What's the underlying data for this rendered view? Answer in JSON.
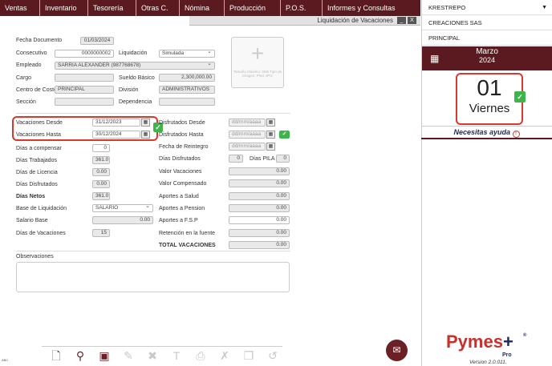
{
  "nav": [
    "Ventas",
    "Inventario",
    "Tesorería",
    "Otras C.",
    "Nómina",
    "Producción",
    "P.O.S.",
    "Informes y Consultas"
  ],
  "window": {
    "title": "Liquidación de Vacaciones",
    "minimize": "_",
    "close": "X"
  },
  "form": {
    "fecha_documento": {
      "label": "Fecha Documento",
      "value": "01/03/2024"
    },
    "consecutivo": {
      "label": "Consecutivo",
      "value": "0000000002"
    },
    "liquidacion": {
      "label": "Liquidación",
      "value": "Simulada"
    },
    "empleado": {
      "label": "Empleado",
      "value": "SARRIA ALEXANDER (987768678)"
    },
    "cargo": {
      "label": "Cargo",
      "value": ""
    },
    "sueldo_basico": {
      "label": "Sueldo Básico",
      "value": "2,300,000.00"
    },
    "centro_costo": {
      "label": "Centro de Costo",
      "value": "PRINCIPAL"
    },
    "division": {
      "label": "División",
      "value": "ADMINISTRATIVOS"
    },
    "seccion": {
      "label": "Sección",
      "value": ""
    },
    "dependencia": {
      "label": "Dependencia",
      "value": ""
    },
    "image_caption": "Tamaño Máximo: 5Mb Tipo de Imagen: PNG-JPG",
    "vacaciones_desde": {
      "label": "Vacaciones Desde",
      "value": "31/12/2023"
    },
    "vacaciones_hasta": {
      "label": "Vacaciones Hasta",
      "value": "30/12/2024"
    },
    "dias_compensar": {
      "label": "Días a compensar",
      "value": "0"
    },
    "dias_trabajados": {
      "label": "Días Trabajados",
      "value": "361.0"
    },
    "dias_licencia": {
      "label": "Días de Licencia",
      "value": "0.00"
    },
    "dias_disfrutados_l": {
      "label": "Días Disfrutados",
      "value": "0.00"
    },
    "dias_netos": {
      "label": "Días Netos",
      "value": "361.0"
    },
    "base_liquidacion": {
      "label": "Base de Liquidación",
      "value": "SALARIO"
    },
    "salario_base": {
      "label": "Salario Base",
      "value": "0.00"
    },
    "dias_vacaciones": {
      "label": "Días de Vacaciones",
      "value": "15"
    },
    "disfrutados_desde": {
      "label": "Disfrutados Desde",
      "placeholder": "dd/mm/aaaa"
    },
    "disfrutados_hasta": {
      "label": "Disfrutados Hasta",
      "placeholder": "dd/mm/aaaa"
    },
    "fecha_reintegro": {
      "label": "Fecha de Reintegro",
      "placeholder": "dd/mm/aaaa"
    },
    "dias_disfrutados_r": {
      "label": "Días Disfrutados",
      "value": "0"
    },
    "dias_pila": {
      "label": "Días PILA",
      "value": "0"
    },
    "valor_vacaciones": {
      "label": "Valor Vacaciones",
      "value": "0.00"
    },
    "valor_compensado": {
      "label": "Valor Compensado",
      "value": "0.00"
    },
    "aportes_salud": {
      "label": "Aportes a Salud",
      "value": "0.00"
    },
    "aportes_pension": {
      "label": "Aportes a Pension",
      "value": "0.00"
    },
    "aportes_fsp": {
      "label": "Aportes a F.S.P",
      "value": "0.00"
    },
    "retencion": {
      "label": "Retención en la fuente",
      "value": "0.00"
    },
    "total_vacaciones": {
      "label": "TOTAL VACACIONES",
      "value": "0.00"
    },
    "observaciones": {
      "label": "Observaciones",
      "value": ""
    }
  },
  "sidebar": {
    "user": "KRESTREPO",
    "company": "CREACIONES SAS",
    "branch": "PRINCIPAL",
    "month": "Marzo",
    "year": "2024",
    "day": "01",
    "weekday": "Viernes",
    "help": "Necesitas ayuda",
    "logo": "Pymes",
    "pro": "Pro",
    "version": "Version 2.0.011."
  },
  "footer_tag": "ABC",
  "icons": {
    "new": "new-document-icon",
    "search": "binoculars-icon",
    "save": "save-icon",
    "edit": "pencil-icon",
    "delete": "x-icon",
    "text": "text-icon",
    "print": "printer-icon",
    "excel": "excel-icon",
    "copy": "copy-icon",
    "history": "history-icon"
  }
}
